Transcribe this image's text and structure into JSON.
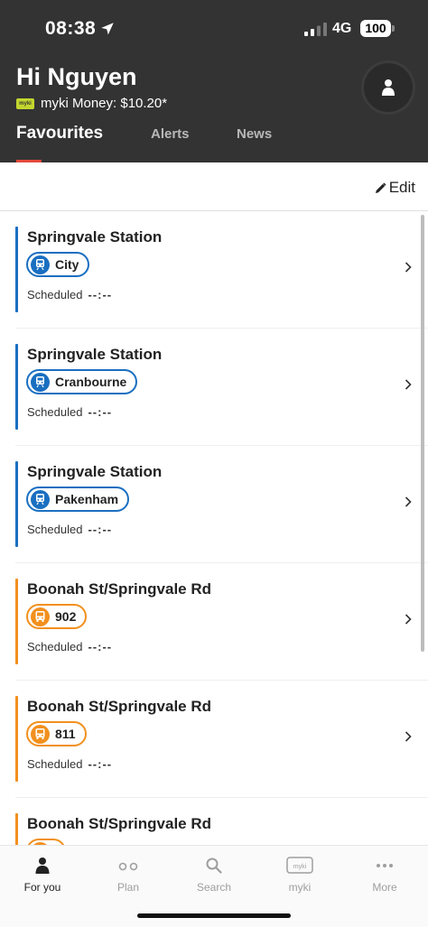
{
  "status": {
    "time": "08:38",
    "network": "4G",
    "battery": "100"
  },
  "header": {
    "greeting": "Hi Nguyen",
    "myki_badge": "myki",
    "myki_money": "myki Money: $10.20*"
  },
  "tabs": [
    {
      "label": "Favourites",
      "active": true
    },
    {
      "label": "Alerts",
      "active": false
    },
    {
      "label": "News",
      "active": false
    }
  ],
  "toolbar": {
    "edit_label": "Edit"
  },
  "colors": {
    "train": "#1a6fc1",
    "bus": "#f2901e",
    "header": "#333333",
    "tab_accent": "#e4493a"
  },
  "favourites": [
    {
      "title": "Springvale Station",
      "mode": "train",
      "route": "City",
      "scheduled_label": "Scheduled",
      "scheduled_time": "--:--"
    },
    {
      "title": "Springvale Station",
      "mode": "train",
      "route": "Cranbourne",
      "scheduled_label": "Scheduled",
      "scheduled_time": "--:--"
    },
    {
      "title": "Springvale Station",
      "mode": "train",
      "route": "Pakenham",
      "scheduled_label": "Scheduled",
      "scheduled_time": "--:--"
    },
    {
      "title": "Boonah St/Springvale Rd",
      "mode": "bus",
      "route": "902",
      "scheduled_label": "Scheduled",
      "scheduled_time": "--:--"
    },
    {
      "title": "Boonah St/Springvale Rd",
      "mode": "bus",
      "route": "811",
      "scheduled_label": "Scheduled",
      "scheduled_time": "--:--"
    },
    {
      "title": "Boonah St/Springvale Rd",
      "mode": "bus",
      "route": "",
      "scheduled_label": "",
      "scheduled_time": ""
    }
  ],
  "bottom_nav": [
    {
      "label": "For you",
      "icon": "person-icon",
      "active": true
    },
    {
      "label": "Plan",
      "icon": "plan-icon",
      "active": false
    },
    {
      "label": "Search",
      "icon": "search-icon",
      "active": false
    },
    {
      "label": "myki",
      "icon": "myki-card-icon",
      "card_text": "myki",
      "active": false
    },
    {
      "label": "More",
      "icon": "more-icon",
      "active": false
    }
  ]
}
